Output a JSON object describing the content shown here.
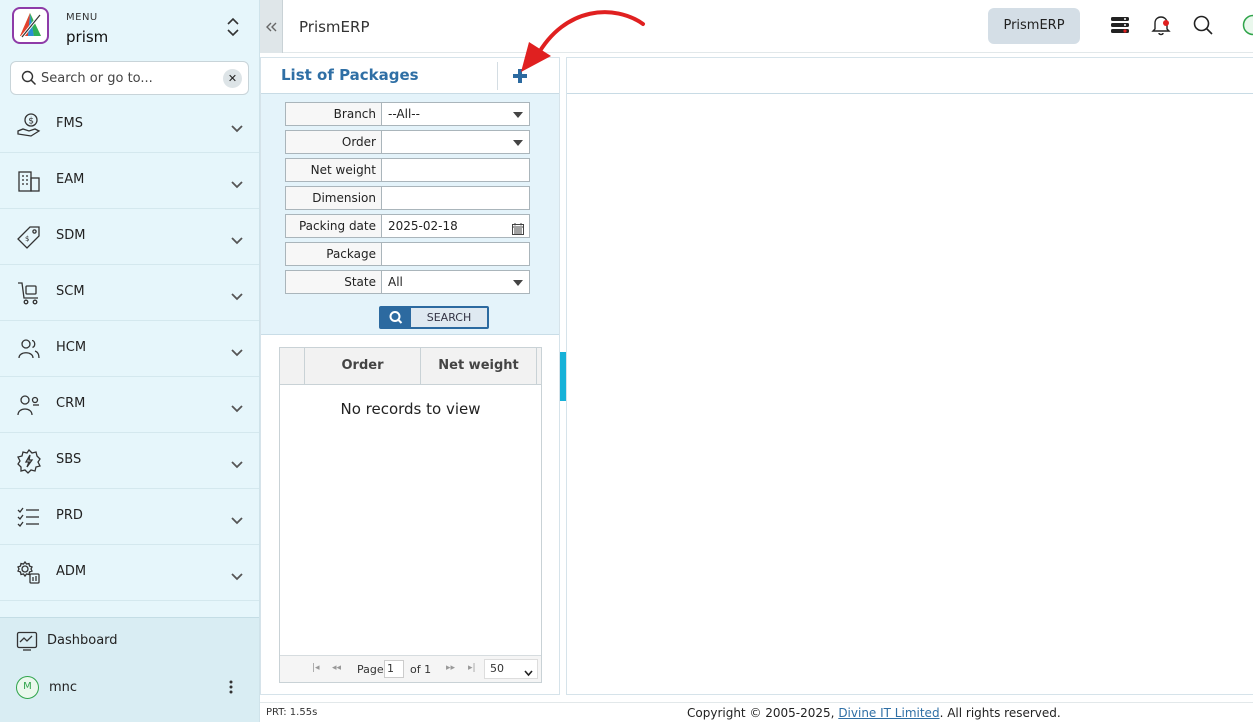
{
  "sidebar": {
    "menu_caption": "MENU",
    "menu_name": "prism",
    "search": {
      "placeholder": "Search or go to..."
    },
    "items": [
      {
        "label": "FMS",
        "icon": "money-hand-icon"
      },
      {
        "label": "EAM",
        "icon": "building-icon"
      },
      {
        "label": "SDM",
        "icon": "tag-icon"
      },
      {
        "label": "SCM",
        "icon": "cart-icon"
      },
      {
        "label": "HCM",
        "icon": "people-icon"
      },
      {
        "label": "CRM",
        "icon": "user-group-icon"
      },
      {
        "label": "SBS",
        "icon": "bolt-gear-icon"
      },
      {
        "label": "PRD",
        "icon": "checklist-icon"
      },
      {
        "label": "ADM",
        "icon": "gear-user-icon"
      }
    ],
    "dashboard_label": "Dashboard",
    "user": {
      "initial": "M",
      "name": "mnc"
    }
  },
  "topbar": {
    "title": "PrismERP",
    "badge": "PrismERP"
  },
  "list_panel": {
    "title": "List of Packages",
    "filters": [
      {
        "label": "Branch",
        "value": "--All--",
        "type": "select"
      },
      {
        "label": "Order",
        "value": "",
        "type": "select"
      },
      {
        "label": "Net weight",
        "value": "",
        "type": "text"
      },
      {
        "label": "Dimension",
        "value": "",
        "type": "text"
      },
      {
        "label": "Packing date",
        "value": "2025-02-18",
        "type": "date"
      },
      {
        "label": "Package",
        "value": "",
        "type": "text"
      },
      {
        "label": "State",
        "value": "All",
        "type": "select"
      }
    ],
    "search_label": "SEARCH",
    "grid": {
      "columns": [
        "Order",
        "Net weight"
      ],
      "empty_text": "No records to view",
      "pager": {
        "page_label": "Page",
        "page_value": "1",
        "of_label": "of 1",
        "page_size": "50"
      }
    }
  },
  "footer": {
    "prt": "PRT: 1.55s",
    "copyright_prefix": "Copyright © 2005-2025, ",
    "company": "Divine IT Limited",
    "copyright_suffix": ". All rights reserved."
  },
  "colors": {
    "sidebar_bg": "#e6f6fb",
    "accent_blue": "#2f6fa5",
    "splitter": "#16b1d8",
    "annotation": "#e02020",
    "avatar_green": "#2fa44a"
  }
}
